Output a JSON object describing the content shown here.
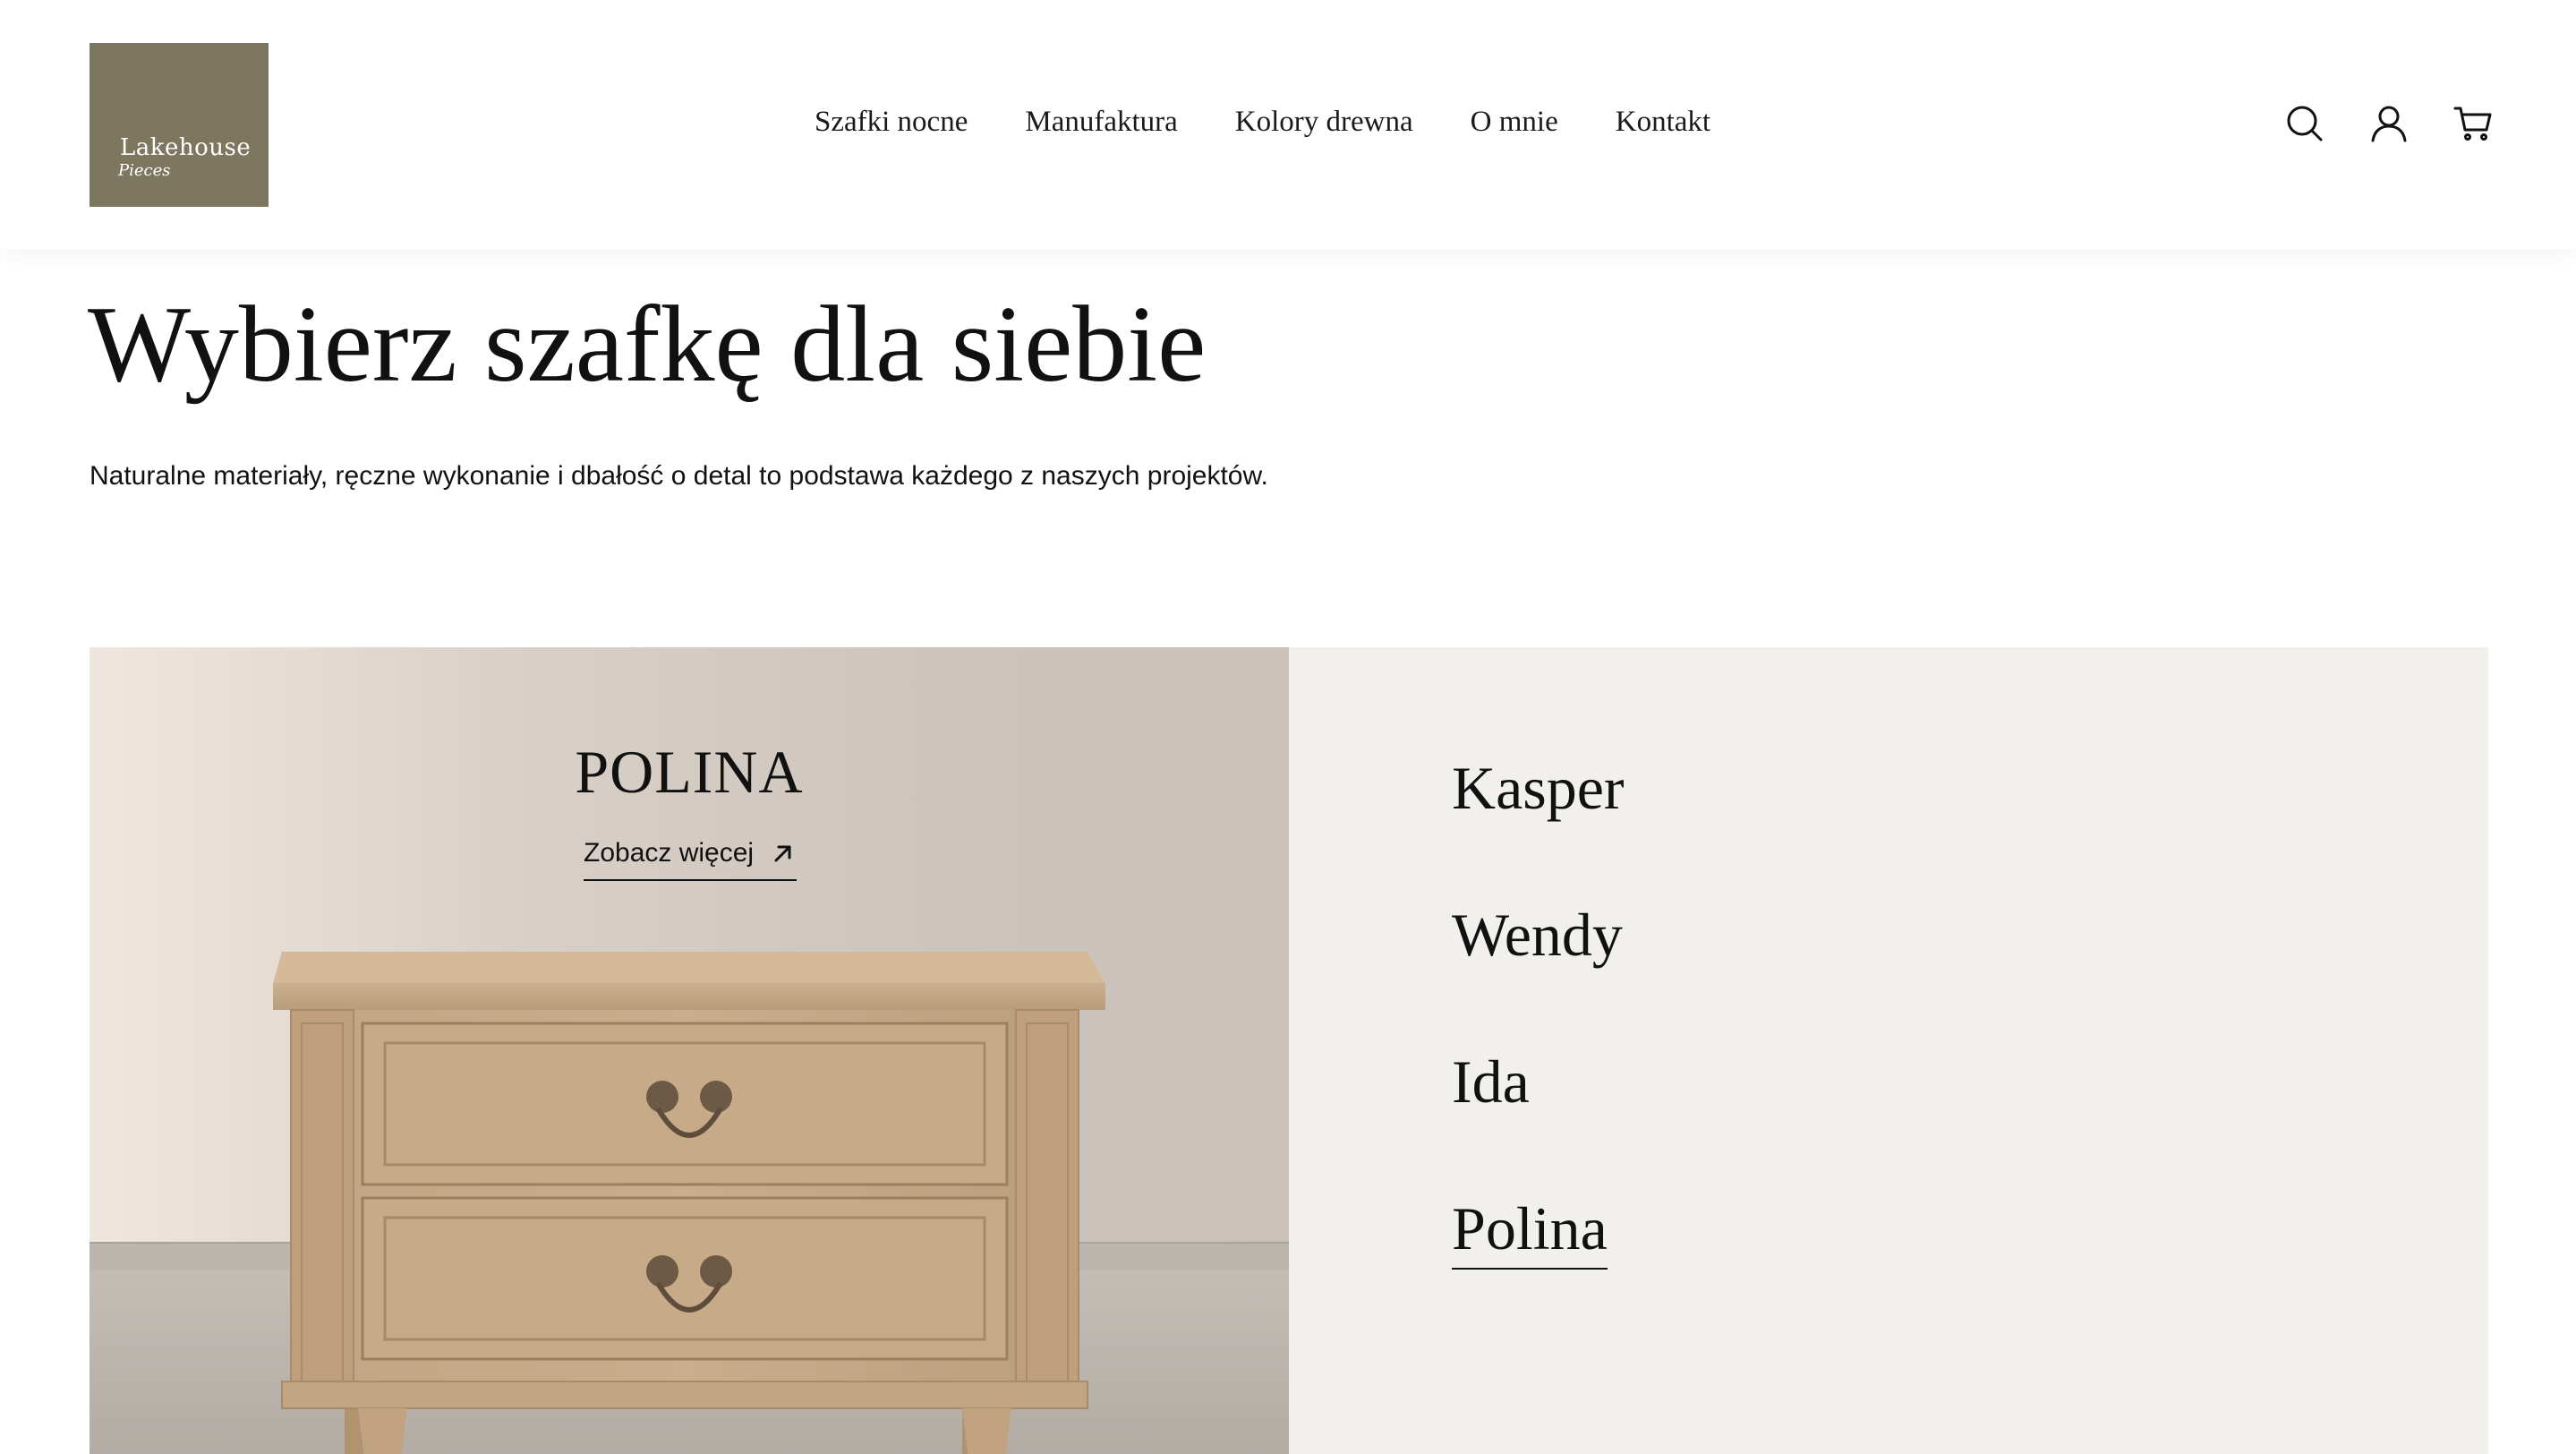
{
  "brand": {
    "logo_main": "Lakehouse",
    "logo_sub": "Pieces",
    "logo_color": "#7d7760"
  },
  "nav": {
    "items": [
      {
        "label": "Szafki nocne"
      },
      {
        "label": "Manufaktura"
      },
      {
        "label": "Kolory drewna"
      },
      {
        "label": "O mnie"
      },
      {
        "label": "Kontakt"
      }
    ]
  },
  "header_icons": [
    "search-icon",
    "user-icon",
    "cart-icon"
  ],
  "intro": {
    "title": "Wybierz szafkę dla siebie",
    "subtitle": "Naturalne materiały, ręczne wykonanie i dbałość o detal to podstawa każdego z naszych projektów."
  },
  "feature": {
    "title": "POLINA",
    "link_label": "Zobacz więcej",
    "link_icon": "arrow-up-right-icon"
  },
  "models": {
    "items": [
      {
        "label": "Kasper"
      },
      {
        "label": "Wendy"
      },
      {
        "label": "Ida"
      },
      {
        "label": "Polina"
      }
    ],
    "active": "Polina"
  },
  "colors": {
    "panel_bg": "#f1f0ec",
    "text": "#111111"
  }
}
